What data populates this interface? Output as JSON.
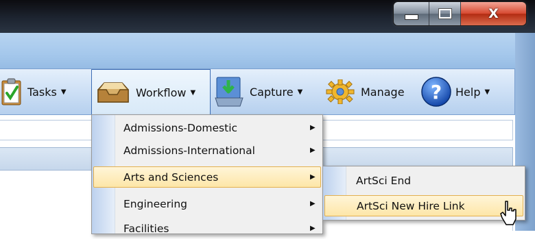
{
  "window": {
    "controls": {
      "minimize": "minimize-icon",
      "maximize": "maximize-icon",
      "close_label": "X"
    }
  },
  "toolbar": {
    "items": [
      {
        "label": "Tasks",
        "icon": "tasks-clipboard-icon",
        "has_arrow": true
      },
      {
        "label": "Workflow",
        "icon": "workflow-inbox-icon",
        "has_arrow": true,
        "active": true
      },
      {
        "label": "Capture",
        "icon": "capture-scanner-icon",
        "has_arrow": true
      },
      {
        "label": "Manage",
        "icon": "manage-gear-icon",
        "has_arrow": false
      },
      {
        "label": "Help",
        "icon": "help-question-icon",
        "has_arrow": true
      }
    ]
  },
  "workflow_menu": {
    "items": [
      {
        "label": "Admissions-Domestic",
        "has_submenu": true
      },
      {
        "label": "Admissions-International",
        "has_submenu": true
      },
      {
        "label": "Arts and Sciences",
        "has_submenu": true,
        "highlighted": true
      },
      {
        "label": "Engineering",
        "has_submenu": true
      },
      {
        "label": "Facilities",
        "has_submenu": true
      }
    ]
  },
  "arts_submenu": {
    "items": [
      {
        "label": "ArtSci End"
      },
      {
        "label": "ArtSci New Hire Link",
        "highlighted": true
      }
    ]
  },
  "colors": {
    "toolbar_active_border": "#3d6db4",
    "menu_highlight": "#fde6a8",
    "menu_highlight_border": "#e3b04f",
    "title_bar": "#1d2430",
    "close_button": "#d6482f"
  }
}
